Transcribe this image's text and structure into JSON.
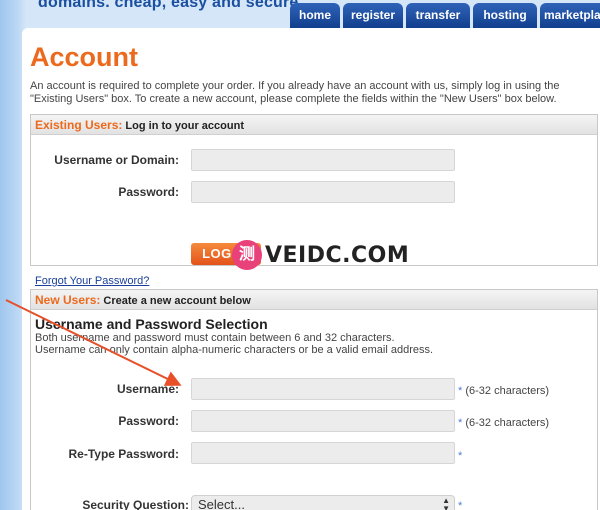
{
  "header": {
    "tagline": "domains. cheap, easy and secure."
  },
  "nav": {
    "items": [
      {
        "label": "home"
      },
      {
        "label": "register"
      },
      {
        "label": "transfer"
      },
      {
        "label": "hosting"
      },
      {
        "label": "marketplace"
      }
    ]
  },
  "page": {
    "title": "Account",
    "intro": "An account is required to complete your order. If you already have an account with us, simply log in using the \"Existing Users\" box. To create a new account, please complete the fields within the \"New Users\" box below."
  },
  "existing": {
    "heading_highlight": "Existing Users:",
    "heading_rest": " Log in to your account",
    "username_label": "Username or Domain:",
    "username_value": "",
    "password_label": "Password:",
    "password_value": "",
    "login_button": "LOG IN",
    "forgot_link": "Forgot Your Password?"
  },
  "newusers": {
    "heading_highlight": "New Users:",
    "heading_rest": " Create a new account below",
    "section_title": "Username and Password Selection",
    "section_desc_1": "Both username and password must contain between 6 and 32 characters.",
    "section_desc_2": "Username can only contain alpha-numeric characters or be a valid email address.",
    "username_label": "Username:",
    "username_hint": "(6-32 characters)",
    "password_label": "Password:",
    "password_hint": "(6-32 characters)",
    "retype_label": "Re-Type Password:",
    "required_mark": "*",
    "security_label": "Security Question:",
    "security_selected": "Select..."
  },
  "watermark": {
    "badge": "测",
    "text": "VEIDC.COM"
  },
  "colors": {
    "accent_orange": "#ec6a1d",
    "nav_blue": "#1b4fa0",
    "annotation_arrow": "#e8502a"
  }
}
